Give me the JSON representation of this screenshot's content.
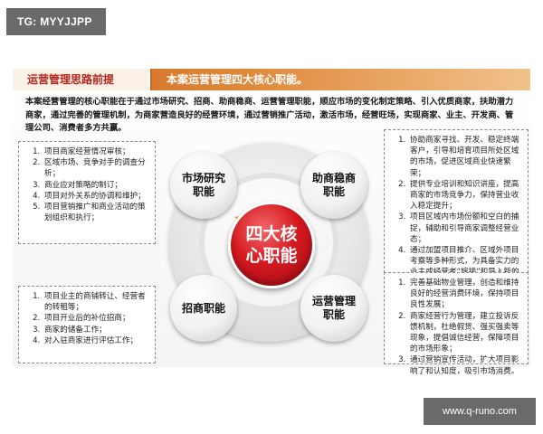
{
  "watermark_tag": "TG: MYYJJPP",
  "watermark_url": "www.q-runo.com",
  "titlebar": {
    "left": "运营管理思路前提",
    "right": "本案运营管理四大核心职能。"
  },
  "intro": "本案经营管理的核心职能在于通过市场研究、招商、助商稳商、运营管理职能，顺应市场的变化制定策略、引入优质商家，扶助潜力商家，通过完善的管理机制，为商家营造良好的经营环境，通过营销推广活动，激活市场，经营旺场，实现商家、业主、开发商、管理公司、消费者多方共赢。",
  "center": "四大核心职能",
  "nodes": {
    "top_left": "市场研究职能",
    "top_right": "助商稳商职能",
    "bottom_left": "招商职能",
    "bottom_right": "运营管理职能"
  },
  "boxes": {
    "top_left": [
      "项目商家经营情况审核；",
      "区域市场、竞争对手的调查分析；",
      "商业应对策略的制订；",
      "项目对外关系的协调和维护；",
      "项目营销推广和商业活动的策划组织和执行；"
    ],
    "bottom_left": [
      "项目业主的商铺转让、经营者的转租等；",
      "项目开业后的补位招商；",
      "商家的储备工作；",
      "对入驻商家进行评估工作；"
    ],
    "top_right": [
      "协助商家寻找、开发、稳定终端客户，引导和培育项目所处区域的市场，促进区域商业快速繁荣；",
      "提供专业培训和知识讲座，提高商家的市场竞争力，保持营业收入稳定提升；",
      "项目区域内市场份额和空白的捕捉，辅助和引导商家调整经营业态；",
      "通过加盟项目推介、区域外项目考察等多种形式，为具备实力的业主或经营者“嫁接”和导入新的商业理念和模式；"
    ],
    "bottom_right": [
      "完善基础物业管理，创造和维持良好的经营消费环境，保持项目良性发展；",
      "商家经营行为管理，建立投诉反馈机制，杜绝假货、强买强卖等现象，提倡诚信经营，保障项目的市场形象；",
      "通过营销宣传活动，扩大项目影响了和认知度，吸引市场消费。"
    ]
  },
  "colors": {
    "accent_red": "#d71920",
    "title_orange": "#e0883a",
    "tab_text": "#b3261e"
  }
}
